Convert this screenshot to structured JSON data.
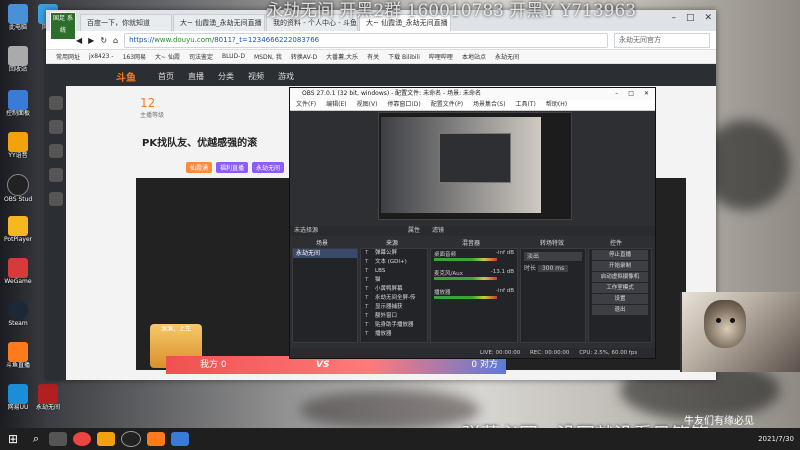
{
  "overlay": {
    "top_text": "永劫无间 开黑2群 160010783 开黑Y Y713963",
    "bottom_text": "弹幕必回，没回就没看见等等",
    "webcam_caption": "牛友们有缘必见"
  },
  "desktop_icons": [
    {
      "label": "此电脑",
      "color": "#4a90d9"
    },
    {
      "label": "网络",
      "color": "#3aa0e0"
    },
    {
      "label": "回收站",
      "color": "#aaaaaa"
    },
    {
      "label": "控制面板",
      "color": "#3a7bd5"
    },
    {
      "label": "YY语音",
      "color": "#f2a20d"
    },
    {
      "label": "OBS Studio",
      "color": "#222222"
    },
    {
      "label": "PotPlayer",
      "color": "#f5b820"
    },
    {
      "label": "WeGame",
      "color": "#d73a3a"
    },
    {
      "label": "Steam",
      "color": "#1b2838"
    },
    {
      "label": "斗鱼直播",
      "color": "#ff7a1a"
    },
    {
      "label": "网易UU",
      "color": "#1c8ed8"
    },
    {
      "label": "永劫无间",
      "color": "#b02020"
    }
  ],
  "browser": {
    "badge": "国足 系统",
    "tabs": [
      {
        "label": "百度一下，你就知道"
      },
      {
        "label": "大~ 仙霞湧_永劫无间直播"
      },
      {
        "label": "我的资料 - 个人中心 - 斗鱼"
      },
      {
        "label": "大~ 仙霞湧_永劫无间直播"
      }
    ],
    "address": {
      "scheme": "https://",
      "host": "www.douyu.com",
      "path": "/8011?_t=1234666222083766"
    },
    "search_placeholder": "永劫无间官方",
    "bookmarks": [
      "常用网址",
      "jx8423 -",
      "163网易",
      "大~ 仙霞",
      "司法鉴定",
      "BLUD-D",
      "MSDN, 我",
      "转换AV-D",
      "大番薯,大乐",
      "有关",
      "下载 Bilibili",
      "哔哩哔哩",
      "本地站点",
      "永劫无间"
    ],
    "site_nav": {
      "logo": "斗鱼",
      "items": [
        "首页",
        "直播",
        "分类",
        "视频",
        "游戏"
      ]
    },
    "room": {
      "fans": "12",
      "fans_label": "主播等级",
      "title": "PK找队友、优越感强的滚",
      "tags": [
        "仙霞湧",
        "福利直播",
        "永劫无间"
      ],
      "pk_left": "我方 0",
      "pk_right": "0 对方",
      "vs": "VS",
      "banner": "渔渔，上车"
    }
  },
  "obs": {
    "title": "OBS 27.0.1 (32 bit, windows) - 配置文件: 未命名 - 场景: 未命名",
    "menu": [
      "文件(F)",
      "编辑(E)",
      "视图(V)",
      "停靠窗口(D)",
      "配置文件(P)",
      "场景集合(S)",
      "工具(T)",
      "帮助(H)"
    ],
    "no_source": "未选择源",
    "props_label": "属性",
    "filters_label": "滤镜",
    "docks": {
      "scenes": "场景",
      "sources": "来源",
      "mixer": "混音器",
      "transitions": "转场特效",
      "controls": "控件"
    },
    "scenes": [
      "永劫无间"
    ],
    "sources": [
      "弹幕公屏",
      "文本 (GDI+)",
      "LBS",
      "猫",
      "小黄鸭屏幕",
      "永劫无间全屏-传",
      "显示器捕获",
      "额外窗口",
      "贴身助手播放器",
      "播放器"
    ],
    "mixer": [
      {
        "name": "桌面音频",
        "db": "-inf dB"
      },
      {
        "name": "麦克风/Aux",
        "db": "-13.1 dB"
      },
      {
        "name": "播放器",
        "db": "-inf dB"
      }
    ],
    "transition": {
      "type": "淡出",
      "duration_label": "时长",
      "duration": "300 ms"
    },
    "controls": [
      "停止直播",
      "开始录制",
      "启动虚拟摄像机",
      "工作室模式",
      "设置",
      "退出"
    ],
    "status": {
      "live": "LIVE: 00:00:00",
      "rec": "REC: 00:00:00",
      "cpu": "CPU: 2.5%, 60.00 fps"
    }
  },
  "taskbar": {
    "start": "⊞",
    "search": "⌕",
    "time": "2021/7/30"
  }
}
